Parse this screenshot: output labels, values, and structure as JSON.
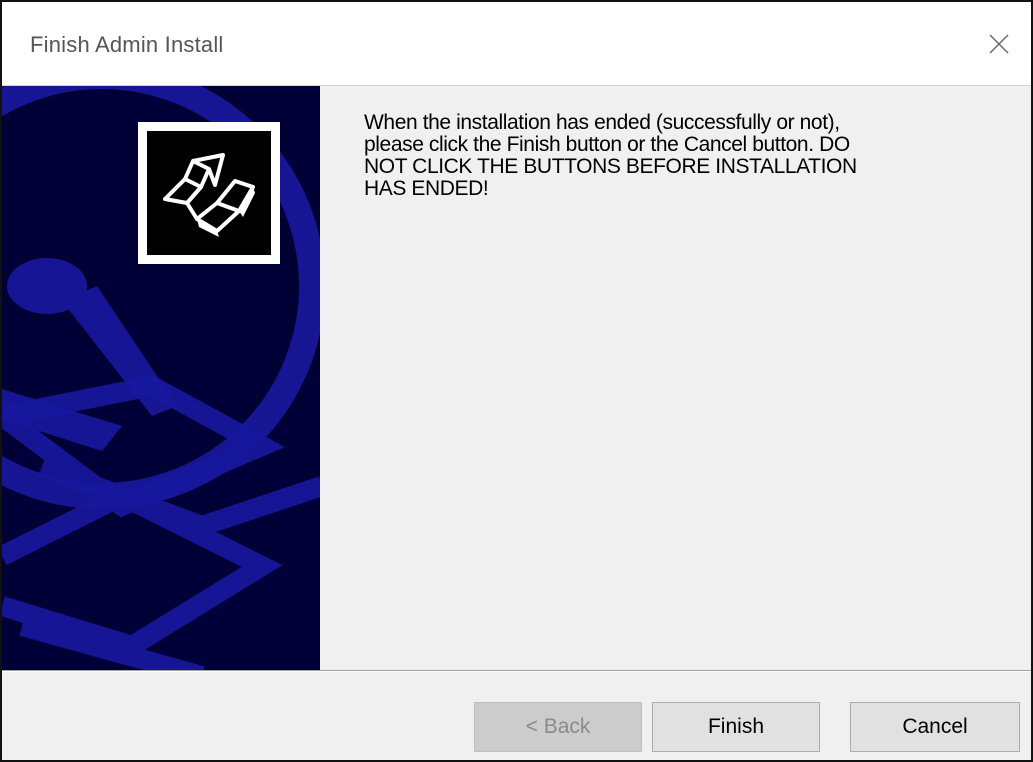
{
  "window": {
    "title": "Finish Admin Install"
  },
  "message": {
    "text": "When the installation has ended (successfully or not),\nplease click the Finish button or the Cancel button.  DO\nNOT CLICK THE BUTTONS BEFORE INSTALLATION\nHAS ENDED!"
  },
  "buttons": {
    "back": "< Back",
    "finish": "Finish",
    "cancel": "Cancel"
  },
  "icons": {
    "close": "close-icon",
    "installer_logo": "installer-arrow-logo"
  },
  "colors": {
    "side_panel": "#000045",
    "side_panel_shapes": "#1a1a9a",
    "dialog_background": "#f0f0f0",
    "button_face": "#e1e1e1"
  }
}
